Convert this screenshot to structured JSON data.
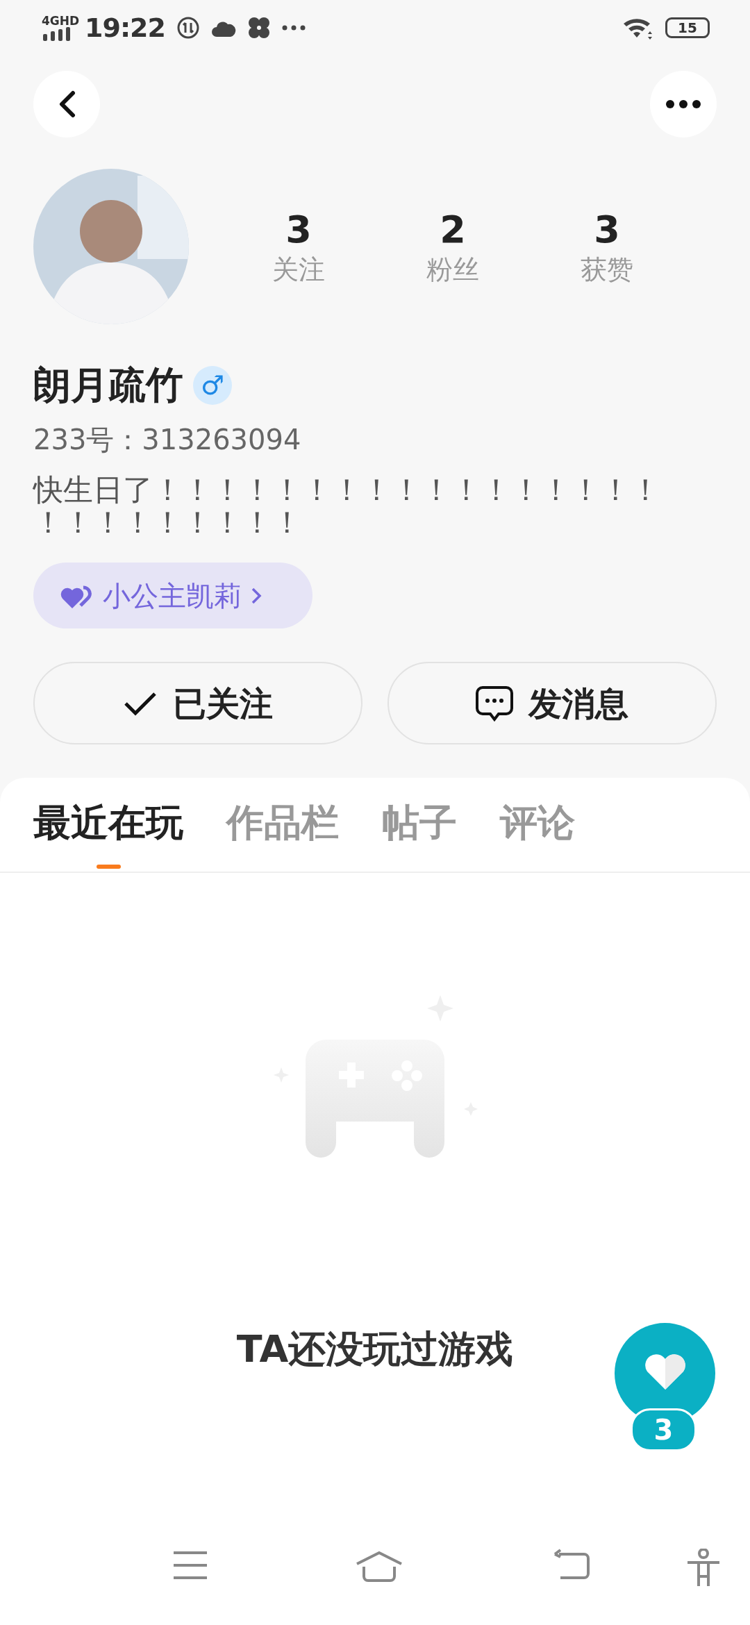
{
  "status_bar": {
    "network": "4GHD",
    "time": "19:22",
    "battery": "15"
  },
  "profile": {
    "stats": [
      {
        "value": "3",
        "label": "关注"
      },
      {
        "value": "2",
        "label": "粉丝"
      },
      {
        "value": "3",
        "label": "获赞"
      }
    ],
    "name": "朗月疏竹",
    "gender_symbol": "♂",
    "id_text": "233号：313263094",
    "bio": "快生日了！！！！！！！！！！！！！！！！！！！！！！！！！！",
    "tag": "小公主凯莉"
  },
  "actions": [
    {
      "kind": "followed",
      "label": "已关注"
    },
    {
      "kind": "message",
      "label": "发消息"
    }
  ],
  "tabs": [
    {
      "label": "最近在玩",
      "selected": true
    },
    {
      "label": "作品栏",
      "selected": false
    },
    {
      "label": "帖子",
      "selected": false
    },
    {
      "label": "评论",
      "selected": false
    }
  ],
  "empty_text": "TA还没玩过游戏",
  "like_count": "3"
}
